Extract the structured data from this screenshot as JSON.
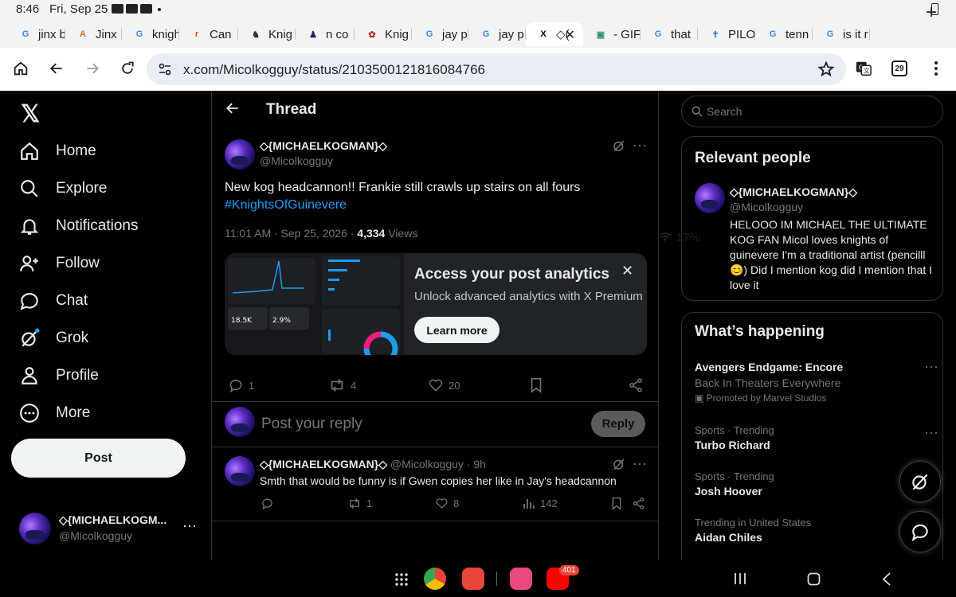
{
  "status_bar": {
    "time": "8:46",
    "date": "Fri, Sep 25",
    "battery": "17%"
  },
  "tabs": [
    {
      "label": "jinx b",
      "fav": "G",
      "fav_color": "#4285f4"
    },
    {
      "label": "Jinx",
      "fav": "A",
      "fav_color": "#e2711d"
    },
    {
      "label": "knigh",
      "fav": "G",
      "fav_color": "#4285f4"
    },
    {
      "label": "Can",
      "fav": "r",
      "fav_color": "#ff4500"
    },
    {
      "label": "Knig",
      "fav": "♞",
      "fav_color": "#333333"
    },
    {
      "label": "n co",
      "fav": "♟",
      "fav_color": "#1f1f6f"
    },
    {
      "label": "Knig",
      "fav": "✿",
      "fav_color": "#b3261e"
    },
    {
      "label": "jay p",
      "fav": "G",
      "fav_color": "#4285f4"
    },
    {
      "label": "jay p",
      "fav": "G",
      "fav_color": "#4285f4"
    },
    {
      "label": "◇(",
      "fav": "X",
      "fav_color": "#000000"
    },
    {
      "label": "- GIF",
      "fav": "▣",
      "fav_color": "#3c8d6e"
    },
    {
      "label": "that",
      "fav": "G",
      "fav_color": "#4285f4"
    },
    {
      "label": "PILO",
      "fav": "✝",
      "fav_color": "#3f74d6"
    },
    {
      "label": "tenn",
      "fav": "G",
      "fav_color": "#4285f4"
    },
    {
      "label": "is it r",
      "fav": "G",
      "fav_color": "#4285f4"
    }
  ],
  "browser": {
    "url": "x.com/Micolkogguy/status/2103500121816084766",
    "tab_count": "29"
  },
  "nav": {
    "items": [
      {
        "label": "Home",
        "icon": "home-icon"
      },
      {
        "label": "Explore",
        "icon": "search-icon"
      },
      {
        "label": "Notifications",
        "icon": "bell-icon"
      },
      {
        "label": "Follow",
        "icon": "follow-icon"
      },
      {
        "label": "Chat",
        "icon": "chat-icon"
      },
      {
        "label": "Grok",
        "icon": "grok-icon"
      },
      {
        "label": "Profile",
        "icon": "profile-icon"
      },
      {
        "label": "More",
        "icon": "more-icon"
      }
    ],
    "post_label": "Post",
    "account": {
      "name": "◇{MICHAELKOGM...",
      "handle": "@Micolkogguy"
    }
  },
  "thread": {
    "title": "Thread",
    "post": {
      "name": "◇{MICHAELKOGMAN}◇",
      "handle": "@Micolkogguy",
      "text": "New kog headcannon!! Frankie still crawls up stairs on all fours",
      "hashtag": "#KnightsOfGuinevere",
      "time": "11:01 AM · Sep 25, 2026 · ",
      "views": "4,334",
      "views_label": " Views",
      "replies": "1",
      "reposts": "4",
      "likes": "20"
    },
    "promo": {
      "title": "Access your post analytics",
      "subtitle": "Unlock advanced analytics with X Premium",
      "button": "Learn more"
    },
    "reply_box": {
      "placeholder": "Post your reply",
      "button": "Reply"
    },
    "reply": {
      "name": "◇{MICHAELKOGMAN}◇",
      "handle": "@Micolkogguy",
      "time": "· 9h",
      "text": "Smth that would be funny is if Gwen copies her like in Jay's headcannon",
      "replies": "",
      "reposts": "1",
      "likes": "8",
      "views": "142"
    }
  },
  "sidebar": {
    "search_placeholder": "Search",
    "relevant": {
      "title": "Relevant people",
      "name": "◇{MICHAELKOGMAN}◇",
      "handle": "@Micolkogguy",
      "bio": "HELOOO IM MICHAEL THE ULTIMATE KOG FAN Micol loves knights of guinevere I'm a traditional artist (pencilll😊) Did I mention kog did I mention that I love it"
    },
    "happening": {
      "title": "What’s happening",
      "items": [
        {
          "title": "Avengers Endgame: Encore",
          "sub": "Back In Theaters Everywhere",
          "promoted": "Promoted by Marvel Studios"
        },
        {
          "context": "Sports · Trending",
          "title": "Turbo Richard"
        },
        {
          "context": "Sports · Trending",
          "title": "Josh Hoover"
        },
        {
          "context": "Trending in United States",
          "title": "Aidan Chiles"
        }
      ]
    }
  },
  "system": {
    "youtube_badge": "401"
  }
}
